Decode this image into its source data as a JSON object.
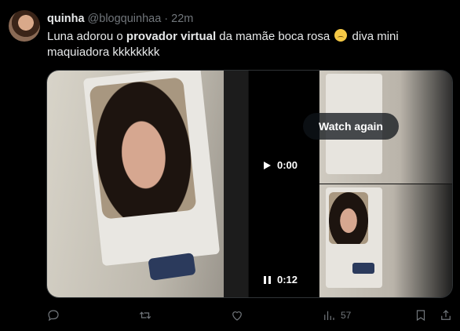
{
  "tweet": {
    "name": "quinha",
    "handle": "@blogquinhaa",
    "dot": "·",
    "time": "22m",
    "text_parts": {
      "before": "Luna adorou o ",
      "bold": "provador virtual",
      "after": " da mamãe boca rosa",
      "after_emoji": " diva mini maquiadora kkkkkkkk"
    }
  },
  "media": {
    "video1": {
      "time": "0:00",
      "state": "play"
    },
    "video2": {
      "time": "0:12",
      "state": "pause"
    },
    "watch_again_label": "Watch again"
  },
  "actions": {
    "views_count": "57"
  },
  "icons": [
    "reply-icon",
    "retweet-icon",
    "like-icon",
    "views-icon",
    "bookmark-icon",
    "share-icon",
    "pleading-face-emoji",
    "play-icon",
    "pause-icon"
  ]
}
